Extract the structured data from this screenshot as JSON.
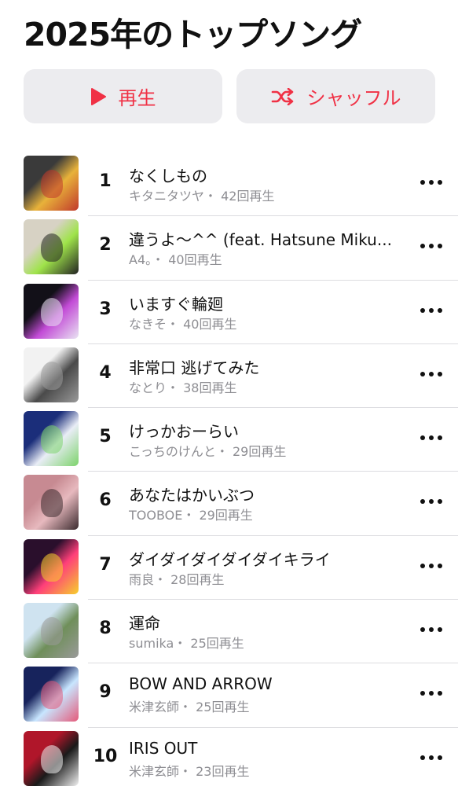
{
  "header": {
    "title": "2025年のトップソング"
  },
  "actions": {
    "play_label": "再生",
    "shuffle_label": "シャッフル",
    "accent_color": "#f03145"
  },
  "songs": [
    {
      "rank": "1",
      "title": "なくしもの",
      "subtitle": "キタニタツヤ・ 42回再生",
      "art_colors": [
        "#3a3a3a",
        "#e8b23a",
        "#c0392b"
      ]
    },
    {
      "rank": "2",
      "title": "違うよ〜^^ (feat. Hatsune Miku...",
      "subtitle": "A4。・ 40回再生",
      "art_colors": [
        "#d7d2c4",
        "#9fe34a",
        "#222222"
      ]
    },
    {
      "rank": "3",
      "title": "いますぐ輪廻",
      "subtitle": "なきそ・ 40回再生",
      "art_colors": [
        "#121018",
        "#c24bd6",
        "#e9e4f2"
      ]
    },
    {
      "rank": "4",
      "title": "非常口 逃げてみた",
      "subtitle": "なとり・ 38回再生",
      "art_colors": [
        "#f2f2f2",
        "#4a4a4a",
        "#9a9a9a"
      ]
    },
    {
      "rank": "5",
      "title": "けっかおーらい",
      "subtitle": "こっちのけんと・ 29回再生",
      "art_colors": [
        "#1b2e7a",
        "#e9edf6",
        "#7cd36b"
      ]
    },
    {
      "rank": "6",
      "title": "あなたはかいぶつ",
      "subtitle": "TOOBOE・ 29回再生",
      "art_colors": [
        "#c78a92",
        "#e7b9be",
        "#3a2a2e"
      ]
    },
    {
      "rank": "7",
      "title": "ダイダイダイダイダイキライ",
      "subtitle": "雨良・ 28回再生",
      "art_colors": [
        "#2a0f2c",
        "#ff3f7a",
        "#f6d02c"
      ]
    },
    {
      "rank": "8",
      "title": "運命",
      "subtitle": "sumika・ 25回再生",
      "art_colors": [
        "#cfe3f0",
        "#6f8f5a",
        "#9a9a9a"
      ]
    },
    {
      "rank": "9",
      "title": "BOW AND ARROW",
      "subtitle": "米津玄師・ 25回再生",
      "art_colors": [
        "#17235c",
        "#c8e6ff",
        "#e45a7a"
      ]
    },
    {
      "rank": "10",
      "title": "IRIS OUT",
      "subtitle": "米津玄師・ 23回再生",
      "art_colors": [
        "#b0162a",
        "#1a1a1a",
        "#f2f2f2"
      ]
    }
  ]
}
